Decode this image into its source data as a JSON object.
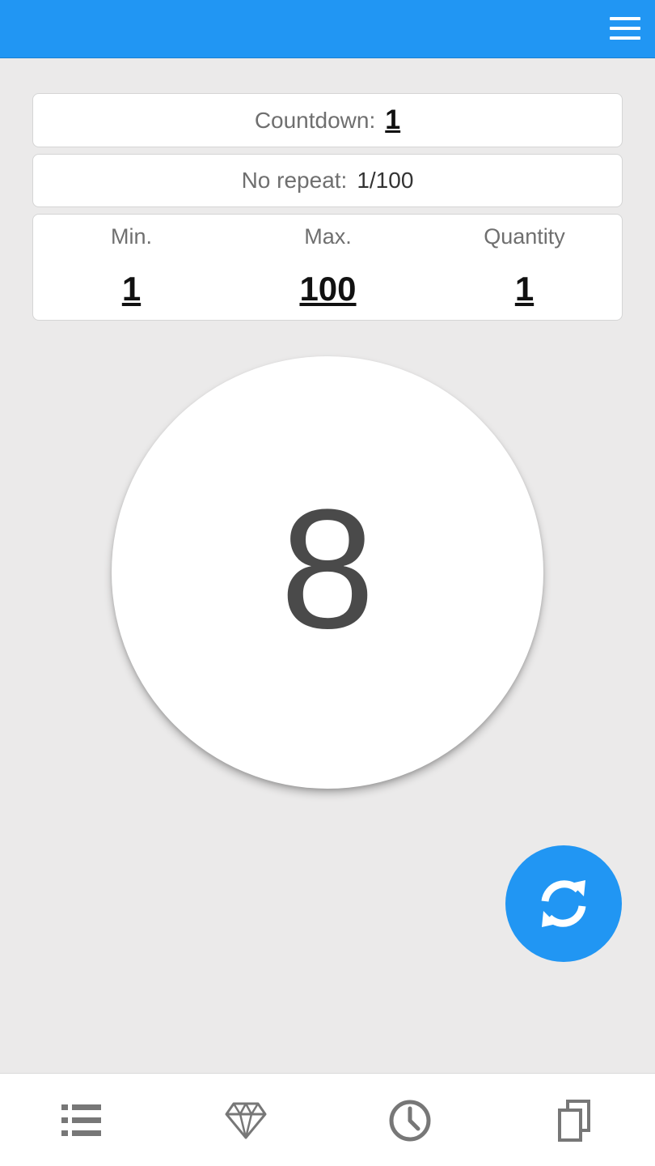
{
  "colors": {
    "accent": "#2196f3",
    "background": "#ebeaea",
    "icon_gray": "#777777"
  },
  "header": {
    "menu_icon": "hamburger-menu-icon"
  },
  "countdown": {
    "label": "Countdown:",
    "value": "1"
  },
  "no_repeat": {
    "label": "No repeat:",
    "value": "1/100"
  },
  "range": {
    "min": {
      "label": "Min.",
      "value": "1"
    },
    "max": {
      "label": "Max.",
      "value": "100"
    },
    "quantity": {
      "label": "Quantity",
      "value": "1"
    }
  },
  "result": {
    "value": "8"
  },
  "fab": {
    "icon": "refresh-icon"
  },
  "bottom_nav": {
    "items": [
      {
        "icon": "list-icon"
      },
      {
        "icon": "diamond-icon"
      },
      {
        "icon": "clock-icon"
      },
      {
        "icon": "copy-icon"
      }
    ]
  }
}
